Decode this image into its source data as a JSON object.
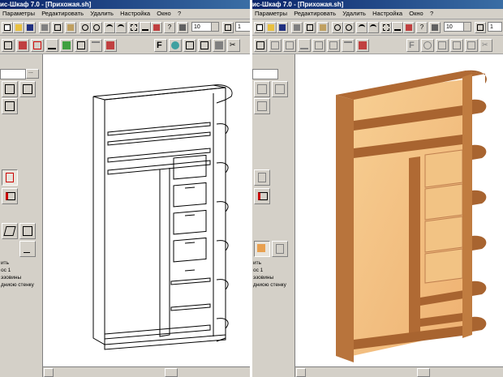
{
  "left_window": {
    "title": "ис-Шкаф 7.0 - [Прихожая.sh]",
    "menu": [
      "Параметры",
      "Редактировать",
      "Удалить",
      "Настройка",
      "Окно",
      "?"
    ],
    "toolbar": {
      "combo_value": "10",
      "combo2_value": "1"
    },
    "panel": {
      "field_value": "",
      "status_lines": [
        "ить",
        "ос 1",
        "эзовины",
        "дниою стенку"
      ]
    }
  },
  "right_window": {
    "title": "ис-Шкаф 7.0 - [Прихожая.sh]",
    "menu": [
      "Параметры",
      "Редактировать",
      "Удалить",
      "Настройка",
      "Окно",
      "?"
    ],
    "toolbar": {
      "combo_value": "10",
      "combo2_value": "1"
    },
    "panel": {
      "field_value": "",
      "status_lines": [
        "ить",
        "ос 1",
        "эзовины",
        "дниою стенку"
      ]
    }
  },
  "colors": {
    "titlebar": "#0a246a",
    "chrome": "#d4d0c8",
    "wood_light": "#f3c07e",
    "wood_dark": "#b06a34"
  },
  "icons": [
    "new-icon",
    "open-icon",
    "save-icon",
    "print-icon",
    "zoom-in-icon",
    "zoom-out-icon",
    "undo-icon",
    "redo-icon",
    "help-icon",
    "font-icon",
    "cut-icon",
    "paste-icon"
  ]
}
